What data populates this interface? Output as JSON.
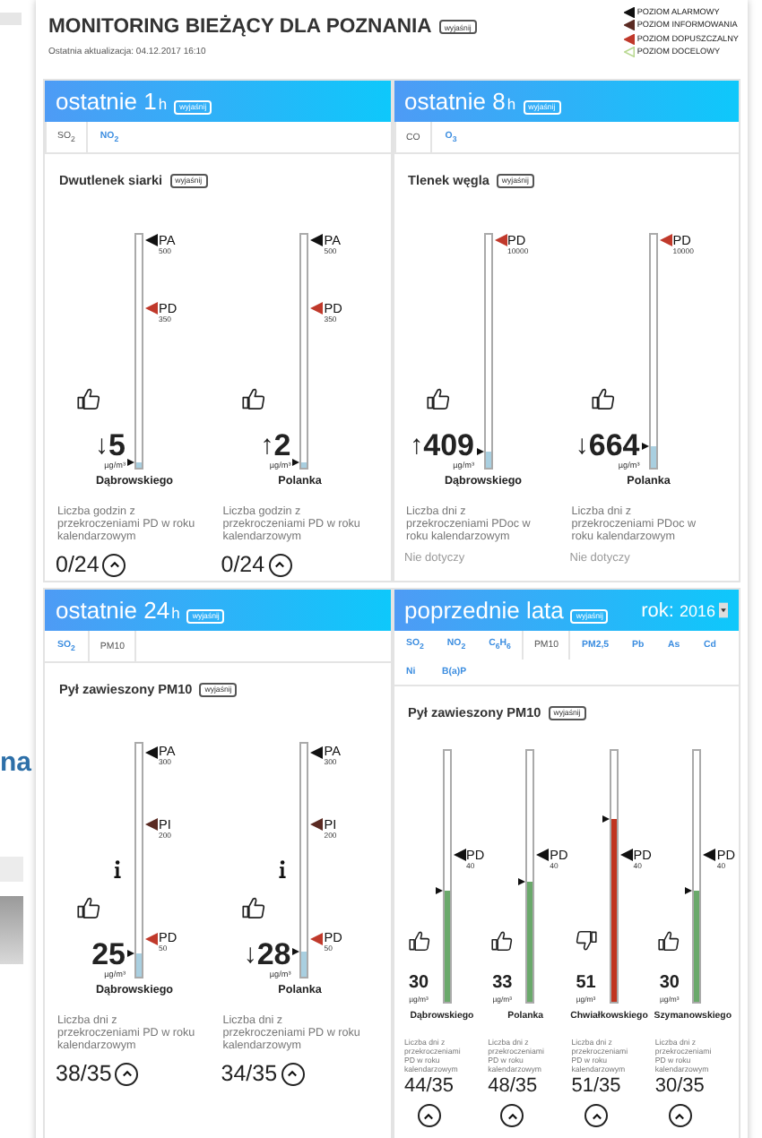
{
  "header": {
    "title": "MONITORING BIEŻĄCY DLA POZNANIA",
    "explain": "wyjaśnij",
    "updated": "Ostatnia aktualizacja: 04.12.2017 16:10"
  },
  "legend": [
    {
      "label": "POZIOM ALARMOWY",
      "color": "#111111",
      "kind": "solid"
    },
    {
      "label": "POZIOM INFORMOWANIA",
      "color": "#5a2a22",
      "kind": "solid"
    },
    {
      "label": "POZIOM DOPUSZCZALNY",
      "color": "#c0392b",
      "kind": "solid"
    },
    {
      "label": "POZIOM DOCELOWY",
      "color": "#b7d88f",
      "kind": "outline"
    }
  ],
  "side": {
    "text": "na"
  },
  "panels": [
    {
      "period": "ostatnie 1",
      "period_unit": "h",
      "explain": "wyjaśnij",
      "kind": "wide",
      "tabs": [
        {
          "label": "SO$_{2}$",
          "selected": true
        },
        {
          "label": "NO$_{2}$",
          "selected": false
        }
      ],
      "pollutant": "Dwutlenek siarki",
      "pollutant_explain": "wyjaśnij",
      "gauges": [
        {
          "station": "Dąbrowskiego",
          "value": "5",
          "unit": "µg/m³",
          "trend": "↓",
          "good": true,
          "info": false,
          "level": 0.02,
          "color": "#a9cfe0",
          "thresholds": [
            {
              "label": "PA",
              "value": "500",
              "color": "#111111",
              "level": 0.97
            },
            {
              "label": "PD",
              "value": "350",
              "color": "#c0392b",
              "level": 0.68
            }
          ],
          "note": "Liczba godzin z przekroczeniami PD w roku kalendarzowym",
          "result": {
            "kind": "ratio",
            "text": "0/24"
          }
        },
        {
          "station": "Polanka",
          "value": "2",
          "unit": "µg/m³",
          "trend": "↑",
          "good": true,
          "info": false,
          "level": 0.02,
          "color": "#a9cfe0",
          "thresholds": [
            {
              "label": "PA",
              "value": "500",
              "color": "#111111",
              "level": 0.97
            },
            {
              "label": "PD",
              "value": "350",
              "color": "#c0392b",
              "level": 0.68
            }
          ],
          "note": "Liczba godzin z przekroczeniami PD w roku kalendarzowym",
          "result": {
            "kind": "ratio",
            "text": "0/24"
          }
        }
      ]
    },
    {
      "period": "ostatnie 8",
      "period_unit": "h",
      "explain": "wyjaśnij",
      "kind": "wide",
      "tabs": [
        {
          "label": "CO",
          "selected": true
        },
        {
          "label": "O$_{3}$",
          "selected": false
        }
      ],
      "pollutant": "Tlenek węgla",
      "pollutant_explain": "wyjaśnij",
      "gauges": [
        {
          "station": "Dąbrowskiego",
          "value": "409",
          "unit": "µg/m³",
          "trend": "↑",
          "good": true,
          "info": false,
          "level": 0.07,
          "color": "#a9cfe0",
          "thresholds": [
            {
              "label": "PD",
              "value": "10000",
              "color": "#c0392b",
              "level": 0.97
            }
          ],
          "note": "Liczba dni z przekroczeniami PDoc w roku kalendarzowym",
          "result": {
            "kind": "not_applicable",
            "text": "Nie dotyczy"
          }
        },
        {
          "station": "Polanka",
          "value": "664",
          "unit": "µg/m³",
          "trend": "↓",
          "good": true,
          "info": false,
          "level": 0.09,
          "color": "#a9cfe0",
          "thresholds": [
            {
              "label": "PD",
              "value": "10000",
              "color": "#c0392b",
              "level": 0.97
            }
          ],
          "note": "Liczba dni z przekroczeniami PDoc w roku kalendarzowym",
          "result": {
            "kind": "not_applicable",
            "text": "Nie dotyczy"
          }
        }
      ]
    },
    {
      "period": "ostatnie 24",
      "period_unit": "h",
      "explain": "wyjaśnij",
      "kind": "wide",
      "tabs": [
        {
          "label": "SO$_{2}$",
          "selected": false
        },
        {
          "label": "PM10",
          "selected": true
        }
      ],
      "pollutant": "Pył zawieszony PM10",
      "pollutant_explain": "wyjaśnij",
      "gauges": [
        {
          "station": "Dąbrowskiego",
          "value": "25",
          "unit": "µg/m³",
          "good": true,
          "info": true,
          "level": 0.1,
          "color": "#a9cfe0",
          "thresholds": [
            {
              "label": "PA",
              "value": "300",
              "color": "#111111",
              "level": 0.96
            },
            {
              "label": "PI",
              "value": "200",
              "color": "#5a2a22",
              "level": 0.65
            },
            {
              "label": "PD",
              "value": "50",
              "color": "#c0392b",
              "level": 0.16
            }
          ],
          "note": "Liczba dni z przekroczeniami PD w roku kalendarzowym",
          "result": {
            "kind": "ratio",
            "text": "38/35"
          }
        },
        {
          "station": "Polanka",
          "value": "28",
          "unit": "µg/m³",
          "trend": "↓",
          "good": true,
          "info": true,
          "level": 0.11,
          "color": "#a9cfe0",
          "thresholds": [
            {
              "label": "PA",
              "value": "300",
              "color": "#111111",
              "level": 0.96
            },
            {
              "label": "PI",
              "value": "200",
              "color": "#5a2a22",
              "level": 0.65
            },
            {
              "label": "PD",
              "value": "50",
              "color": "#c0392b",
              "level": 0.16
            }
          ],
          "note": "Liczba dni z przekroczeniami PD w roku kalendarzowym",
          "result": {
            "kind": "ratio",
            "text": "34/35"
          }
        }
      ]
    },
    {
      "period": "poprzednie lata",
      "explain": "wyjaśnij",
      "year_label": "rok:",
      "year": "2016",
      "kind": "narrow",
      "tabs": [
        {
          "label": "SO$_{2}$",
          "selected": false
        },
        {
          "label": "NO$_{2}$",
          "selected": false
        },
        {
          "label": "C$_{6}$H$_{6}$",
          "selected": false
        },
        {
          "label": "PM10",
          "selected": true
        },
        {
          "label": "PM2,5",
          "selected": false
        },
        {
          "label": "Pb",
          "selected": false
        },
        {
          "label": "As",
          "selected": false
        },
        {
          "label": "Cd",
          "selected": false
        },
        {
          "label": "Ni",
          "selected": false
        },
        {
          "label": "B(a)P",
          "selected": false
        }
      ],
      "pollutant": "Pył zawieszony PM10",
      "pollutant_explain": "wyjaśnij",
      "gauges": [
        {
          "station": "Dąbrowskiego",
          "value": "30",
          "unit": "µg/m³",
          "good": true,
          "info": false,
          "level": 0.44,
          "color": "#6aa96b",
          "thresholds": [
            {
              "label": "PD",
              "value": "40",
              "color": "#111111",
              "level": 0.58
            }
          ],
          "note": "Liczba dni z przekroczeniami PD w roku kalendarzowym",
          "result": {
            "kind": "ratio",
            "text": "44/35"
          }
        },
        {
          "station": "Polanka",
          "value": "33",
          "unit": "µg/m³",
          "good": true,
          "info": false,
          "level": 0.48,
          "color": "#6aa96b",
          "thresholds": [
            {
              "label": "PD",
              "value": "40",
              "color": "#111111",
              "level": 0.58
            }
          ],
          "note": "Liczba dni z przekroczeniami PD w roku kalendarzowym",
          "result": {
            "kind": "ratio",
            "text": "48/35"
          }
        },
        {
          "station": "Chwiałkowskiego",
          "value": "51",
          "unit": "µg/m³",
          "good": false,
          "info": false,
          "level": 0.73,
          "color": "#c0341f",
          "thresholds": [
            {
              "label": "PD",
              "value": "40",
              "color": "#111111",
              "level": 0.58
            }
          ],
          "note": "Liczba dni z przekroczeniami PD w roku kalendarzowym",
          "result": {
            "kind": "ratio",
            "text": "51/35"
          }
        },
        {
          "station": "Szymanowskiego",
          "value": "30",
          "unit": "µg/m³",
          "good": true,
          "info": false,
          "level": 0.44,
          "color": "#6aa96b",
          "thresholds": [
            {
              "label": "PD",
              "value": "40",
              "color": "#111111",
              "level": 0.58
            }
          ],
          "note": "Liczba dni z przekroczeniami PD w roku kalendarzowym",
          "result": {
            "kind": "ratio",
            "text": "30/35"
          }
        }
      ]
    }
  ]
}
